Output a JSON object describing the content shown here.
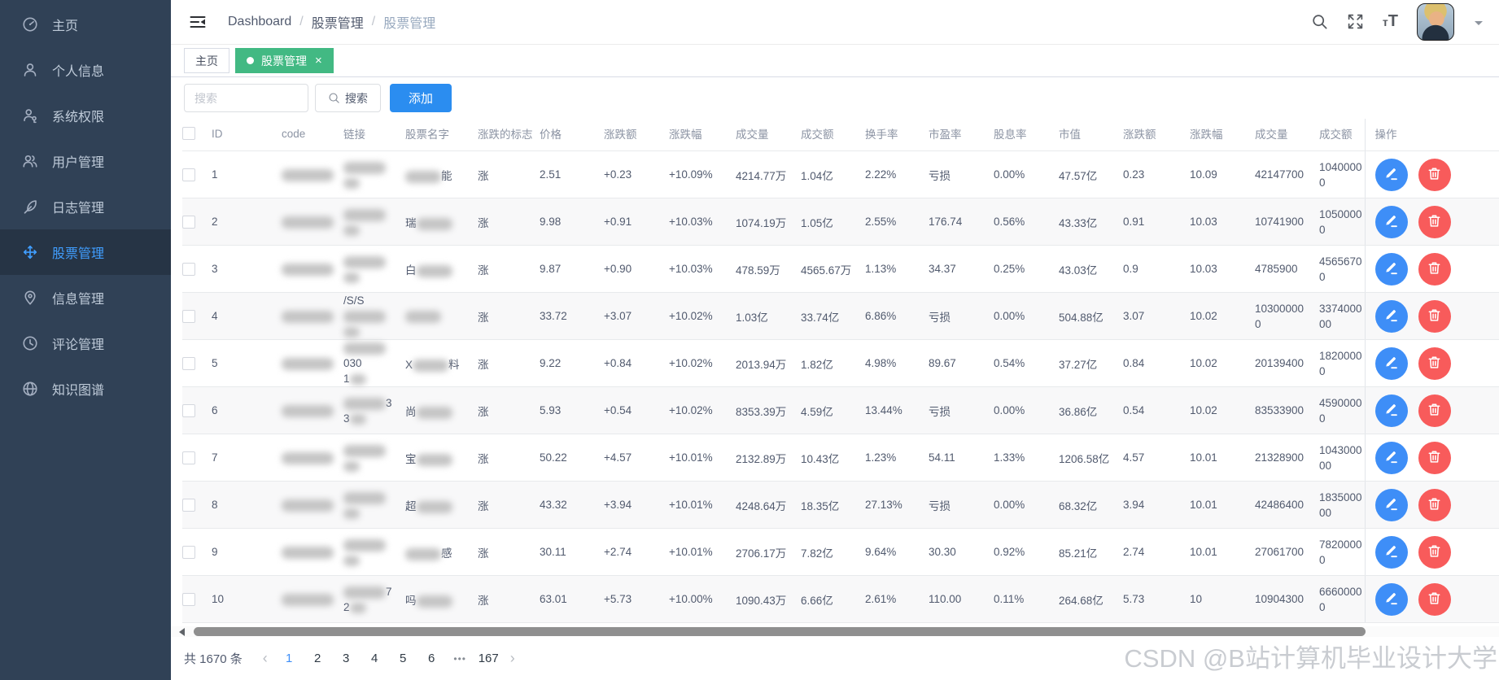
{
  "sidebar": {
    "items": [
      {
        "label": "主页",
        "icon": "dashboard-icon",
        "active": false
      },
      {
        "label": "个人信息",
        "icon": "profile-icon",
        "active": false
      },
      {
        "label": "系统权限",
        "icon": "permission-icon",
        "active": false
      },
      {
        "label": "用户管理",
        "icon": "users-icon",
        "active": false
      },
      {
        "label": "日志管理",
        "icon": "log-feather-icon",
        "active": false
      },
      {
        "label": "股票管理",
        "icon": "stock-move-icon",
        "active": true
      },
      {
        "label": "信息管理",
        "icon": "message-pin-icon",
        "active": false
      },
      {
        "label": "评论管理",
        "icon": "comment-clock-icon",
        "active": false
      },
      {
        "label": "知识图谱",
        "icon": "knowledge-globe-icon",
        "active": false
      }
    ]
  },
  "topbar": {
    "breadcrumb": [
      {
        "label": "Dashboard",
        "muted": false
      },
      {
        "label": "股票管理",
        "muted": false
      },
      {
        "label": "股票管理",
        "muted": true
      }
    ],
    "font_size_icon_text_small": "т",
    "font_size_icon_text_big": "T"
  },
  "tabs": [
    {
      "label": "主页",
      "active": false,
      "closable": false
    },
    {
      "label": "股票管理",
      "active": true,
      "closable": true
    }
  ],
  "glyphs": {
    "tab_close": "×",
    "chevron_left": "‹",
    "chevron_right": "›"
  },
  "toolbar": {
    "search_placeholder": "搜索",
    "search_button_label": "搜索",
    "add_button_label": "添加"
  },
  "table": {
    "headers": [
      "ID",
      "code",
      "链接",
      "股票名字",
      "涨跌的标志",
      "价格",
      "涨跌额",
      "涨跌幅",
      "成交量",
      "成交额",
      "换手率",
      "市盈率",
      "股息率",
      "市值",
      "涨跌额",
      "涨跌幅",
      "成交量",
      "成交额",
      "操作"
    ],
    "rows": [
      {
        "id": "1",
        "name_pre": "",
        "name_post": "能",
        "link_pre1": "",
        "link_post1": "",
        "link_pre2": "",
        "flag": "涨",
        "price": "2.51",
        "change_amount": "+0.23",
        "change_percent": "+10.09%",
        "volume": "4214.77万",
        "amount": "1.04亿",
        "turnover_rate": "2.22%",
        "pe_ratio": "亏损",
        "dividend_yield": "0.00%",
        "market_cap": "47.57亿",
        "change_amount_raw": "0.23",
        "change_percent_raw": "10.09",
        "volume_raw": "42147700",
        "amount_raw": "1040000\n0"
      },
      {
        "id": "2",
        "name_pre": "瑞",
        "name_post": "",
        "link_pre1": "",
        "link_post1": "",
        "link_pre2": "",
        "flag": "涨",
        "price": "9.98",
        "change_amount": "+0.91",
        "change_percent": "+10.03%",
        "volume": "1074.19万",
        "amount": "1.05亿",
        "turnover_rate": "2.55%",
        "pe_ratio": "176.74",
        "dividend_yield": "0.56%",
        "market_cap": "43.33亿",
        "change_amount_raw": "0.91",
        "change_percent_raw": "10.03",
        "volume_raw": "10741900",
        "amount_raw": "1050000\n0"
      },
      {
        "id": "3",
        "name_pre": "白",
        "name_post": "",
        "link_pre1": "",
        "link_post1": "",
        "link_pre2": "",
        "flag": "涨",
        "price": "9.87",
        "change_amount": "+0.90",
        "change_percent": "+10.03%",
        "volume": "478.59万",
        "amount": "4565.67万",
        "turnover_rate": "1.13%",
        "pe_ratio": "34.37",
        "dividend_yield": "0.25%",
        "market_cap": "43.03亿",
        "change_amount_raw": "0.9",
        "change_percent_raw": "10.03",
        "volume_raw": "4785900",
        "amount_raw": "4565670\n0"
      },
      {
        "id": "4",
        "name_pre": "",
        "name_post": "",
        "link_pre1": "/S/S",
        "link_post1": "",
        "link_pre2": "",
        "flag": "涨",
        "price": "33.72",
        "change_amount": "+3.07",
        "change_percent": "+10.02%",
        "volume": "1.03亿",
        "amount": "33.74亿",
        "turnover_rate": "6.86%",
        "pe_ratio": "亏损",
        "dividend_yield": "0.00%",
        "market_cap": "504.88亿",
        "change_amount_raw": "3.07",
        "change_percent_raw": "10.02",
        "volume_raw": "10300000\n0",
        "amount_raw": "3374000\n00"
      },
      {
        "id": "5",
        "name_pre": "X",
        "name_post": "料",
        "link_pre1": "",
        "link_post1": "030",
        "link_pre2": "1",
        "flag": "涨",
        "price": "9.22",
        "change_amount": "+0.84",
        "change_percent": "+10.02%",
        "volume": "2013.94万",
        "amount": "1.82亿",
        "turnover_rate": "4.98%",
        "pe_ratio": "89.67",
        "dividend_yield": "0.54%",
        "market_cap": "37.27亿",
        "change_amount_raw": "0.84",
        "change_percent_raw": "10.02",
        "volume_raw": "20139400",
        "amount_raw": "1820000\n0"
      },
      {
        "id": "6",
        "name_pre": "尚",
        "name_post": "",
        "link_pre1": "",
        "link_post1": "3",
        "link_pre2": "3",
        "flag": "涨",
        "price": "5.93",
        "change_amount": "+0.54",
        "change_percent": "+10.02%",
        "volume": "8353.39万",
        "amount": "4.59亿",
        "turnover_rate": "13.44%",
        "pe_ratio": "亏损",
        "dividend_yield": "0.00%",
        "market_cap": "36.86亿",
        "change_amount_raw": "0.54",
        "change_percent_raw": "10.02",
        "volume_raw": "83533900",
        "amount_raw": "4590000\n0"
      },
      {
        "id": "7",
        "name_pre": "宝",
        "name_post": "",
        "link_pre1": "",
        "link_post1": "",
        "link_pre2": "",
        "flag": "涨",
        "price": "50.22",
        "change_amount": "+4.57",
        "change_percent": "+10.01%",
        "volume": "2132.89万",
        "amount": "10.43亿",
        "turnover_rate": "1.23%",
        "pe_ratio": "54.11",
        "dividend_yield": "1.33%",
        "market_cap": "1206.58亿",
        "change_amount_raw": "4.57",
        "change_percent_raw": "10.01",
        "volume_raw": "21328900",
        "amount_raw": "1043000\n00"
      },
      {
        "id": "8",
        "name_pre": "超",
        "name_post": "",
        "link_pre1": "",
        "link_post1": "",
        "link_pre2": "",
        "flag": "涨",
        "price": "43.32",
        "change_amount": "+3.94",
        "change_percent": "+10.01%",
        "volume": "4248.64万",
        "amount": "18.35亿",
        "turnover_rate": "27.13%",
        "pe_ratio": "亏损",
        "dividend_yield": "0.00%",
        "market_cap": "68.32亿",
        "change_amount_raw": "3.94",
        "change_percent_raw": "10.01",
        "volume_raw": "42486400",
        "amount_raw": "1835000\n00"
      },
      {
        "id": "9",
        "name_pre": "",
        "name_post": "感",
        "link_pre1": "",
        "link_post1": "",
        "link_pre2": "",
        "flag": "涨",
        "price": "30.11",
        "change_amount": "+2.74",
        "change_percent": "+10.01%",
        "volume": "2706.17万",
        "amount": "7.82亿",
        "turnover_rate": "9.64%",
        "pe_ratio": "30.30",
        "dividend_yield": "0.92%",
        "market_cap": "85.21亿",
        "change_amount_raw": "2.74",
        "change_percent_raw": "10.01",
        "volume_raw": "27061700",
        "amount_raw": "7820000\n0"
      },
      {
        "id": "10",
        "name_pre": "吗",
        "name_post": "",
        "link_pre1": "",
        "link_post1": "7",
        "link_pre2": "2",
        "flag": "涨",
        "price": "63.01",
        "change_amount": "+5.73",
        "change_percent": "+10.00%",
        "volume": "1090.43万",
        "amount": "6.66亿",
        "turnover_rate": "2.61%",
        "pe_ratio": "110.00",
        "dividend_yield": "0.11%",
        "market_cap": "264.68亿",
        "change_amount_raw": "5.73",
        "change_percent_raw": "10",
        "volume_raw": "10904300",
        "amount_raw": "6660000\n0"
      }
    ]
  },
  "pagination": {
    "total_label": "共 1670 条",
    "pages": [
      "1",
      "2",
      "3",
      "4",
      "5",
      "6",
      "•••",
      "167"
    ],
    "active_page": "1"
  },
  "watermark": "CSDN @B站计算机毕业设计大学",
  "colors": {
    "sidebar_bg": "#304156",
    "sidebar_active_bg": "#263445",
    "accent_blue": "#409eff",
    "tab_green": "#42b983",
    "add_button_blue": "#2b8df0",
    "edit_blue": "#3e8ef7",
    "delete_red": "#f85b5b"
  }
}
